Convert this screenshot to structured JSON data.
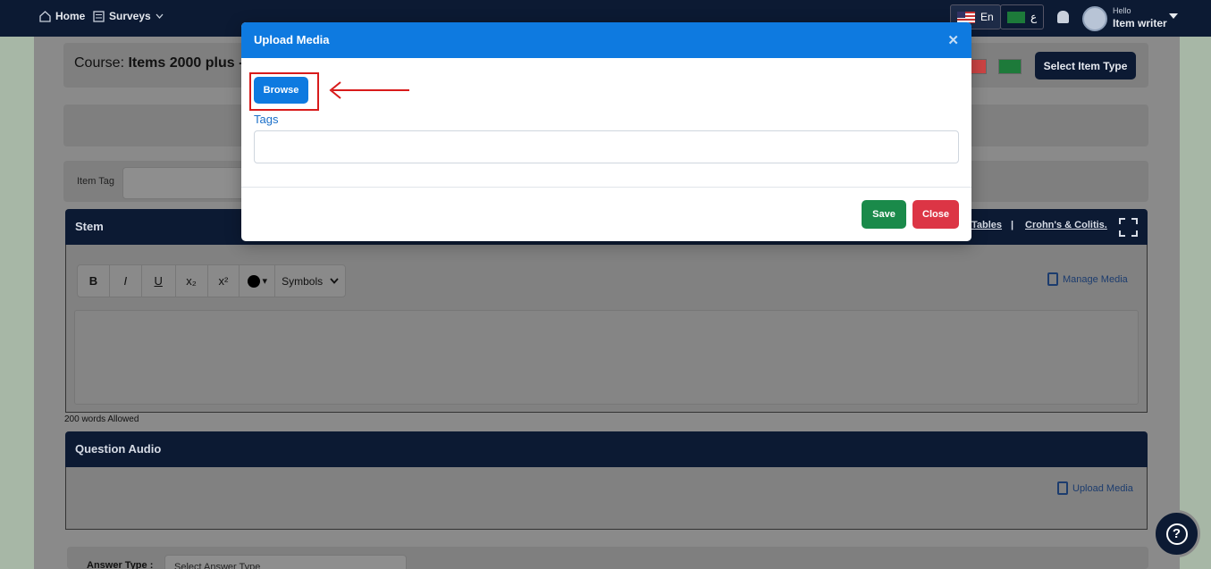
{
  "topbar": {
    "home_label": "Home",
    "surveys_label": "Surveys",
    "lang_en": "En",
    "lang_ar": "ع",
    "user_greeting": "Hello",
    "user_name": "Item writer"
  },
  "page": {
    "course_prefix": "Course:",
    "course_name": "Items 2000 plus -",
    "select_item_type": "Select Item Type",
    "item_tag_label": "Item Tag",
    "stem_title": "Stem",
    "stem_link_tables": "Tables",
    "stem_link_separator": "|",
    "stem_link_crohns": "Crohn's & Colitis.",
    "toolbar": {
      "bold": "B",
      "italic": "I",
      "underline": "U",
      "subscript": "x₂",
      "superscript": "x²",
      "color_caret": "▾",
      "symbols": "Symbols"
    },
    "manage_media": "Manage Media",
    "words_allowed": "200 words Allowed",
    "question_audio_title": "Question Audio",
    "upload_media": "Upload Media",
    "answer_type_label": "Answer Type :",
    "answer_type_placeholder": "Select Answer Type"
  },
  "modal": {
    "title": "Upload Media",
    "browse_label": "Browse",
    "tags_label": "Tags",
    "tags_value": "",
    "save_label": "Save",
    "close_label": "Close"
  },
  "help": {
    "label": "?"
  },
  "colors": {
    "navy": "#0c1a33",
    "modal_blue": "#0e7ae0",
    "save_green": "#1a8a4a",
    "close_red": "#dc3545",
    "highlight_red": "#d81b1b"
  }
}
